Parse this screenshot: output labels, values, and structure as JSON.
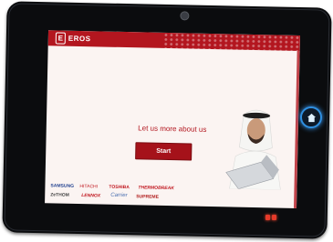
{
  "header": {
    "logo_text": "EROS"
  },
  "main": {
    "prompt": "Let us more about us",
    "start_label": "Start"
  },
  "brands": [
    {
      "name": "SAMSUNG",
      "color": "#1f3f8f"
    },
    {
      "name": "HITACHI",
      "color": "#c0151d"
    },
    {
      "name": "TOSHIBA",
      "color": "#c0151d"
    },
    {
      "name": "THERMOBREAK",
      "color": "#c0151d"
    },
    {
      "name": "ZeTHOM",
      "color": "#444444"
    },
    {
      "name": "LENNOX",
      "color": "#c0151d"
    },
    {
      "name": "Carrier",
      "color": "#4a6fb0"
    },
    {
      "name": "SUPREME",
      "color": "#b01a1a"
    }
  ],
  "colors": {
    "accent": "#b3161f",
    "home_glow": "#3aa0ff"
  }
}
